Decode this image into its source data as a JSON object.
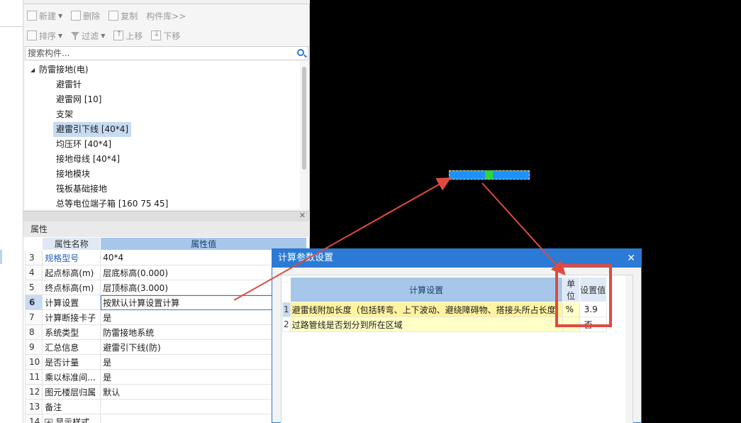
{
  "library": {
    "toolbar_row1": [
      {
        "label": "新建",
        "icon": "new-file-icon",
        "dropdown": true
      },
      {
        "label": "删除",
        "icon": "delete-icon",
        "dropdown": false
      },
      {
        "label": "复制",
        "icon": "copy-icon",
        "dropdown": false
      },
      {
        "label": "构件库>>",
        "icon": "",
        "dropdown": false
      }
    ],
    "toolbar_row2": [
      {
        "label": "排序",
        "icon": "sort-icon",
        "dropdown": true
      },
      {
        "label": "过滤",
        "icon": "filter-icon",
        "dropdown": true
      },
      {
        "label": "上移",
        "icon": "move-up-icon",
        "dropdown": false
      },
      {
        "label": "下移",
        "icon": "move-down-icon",
        "dropdown": false
      }
    ],
    "search_placeholder": "搜索构件...",
    "tree": {
      "root": "防雷接地(电)",
      "items": [
        "避雷针",
        "避雷网 [10]",
        "支架",
        "避雷引下线 [40*4]",
        "均压环 [40*4]",
        "接地母线 [40*4]",
        "接地模块",
        "筏板基础接地",
        "总等电位端子箱 [160 75 45]"
      ],
      "selected_index": 3
    }
  },
  "properties": {
    "title": "属性",
    "col_name": "属性名称",
    "col_value": "属性值",
    "rows": [
      {
        "no": "3",
        "name": "规格型号",
        "value": "40*4"
      },
      {
        "no": "4",
        "name": "起点标高(m)",
        "value": "层底标高(0.000)"
      },
      {
        "no": "5",
        "name": "终点标高(m)",
        "value": "层顶标高(3.000)"
      },
      {
        "no": "6",
        "name": "计算设置",
        "value": "按默认计算设置计算"
      },
      {
        "no": "7",
        "name": "计算断接卡子",
        "value": "是"
      },
      {
        "no": "8",
        "name": "系统类型",
        "value": "防雷接地系统"
      },
      {
        "no": "9",
        "name": "汇总信息",
        "value": "避雷引下线(防)"
      },
      {
        "no": "10",
        "name": "是否计量",
        "value": "是"
      },
      {
        "no": "11",
        "name": "乘以标准间...",
        "value": "是"
      },
      {
        "no": "12",
        "name": "图元楼层归属",
        "value": "默认"
      },
      {
        "no": "13",
        "name": "备注",
        "value": ""
      },
      {
        "no": "14",
        "name": "显示样式",
        "value": ""
      }
    ],
    "active_row": "6"
  },
  "dialog": {
    "title": "计算参数设置",
    "col_setting": "计算设置",
    "col_unit": "单位",
    "col_value": "设置值",
    "rows": [
      {
        "no": "1",
        "setting": "避雷线附加长度（包括转弯、上下波动、避绕障碍物、搭接头所占长度",
        "unit": "%",
        "value": "3.9"
      },
      {
        "no": "2",
        "setting": "过路管线是否划分到所在区域",
        "unit": "",
        "value": "否"
      }
    ]
  },
  "colors": {
    "dialog_title_bg": "#2b7bd6",
    "highlight_red": "#e04a3f",
    "line_bar": "#1e90ff",
    "line_bar_mid": "#2bd53a"
  }
}
